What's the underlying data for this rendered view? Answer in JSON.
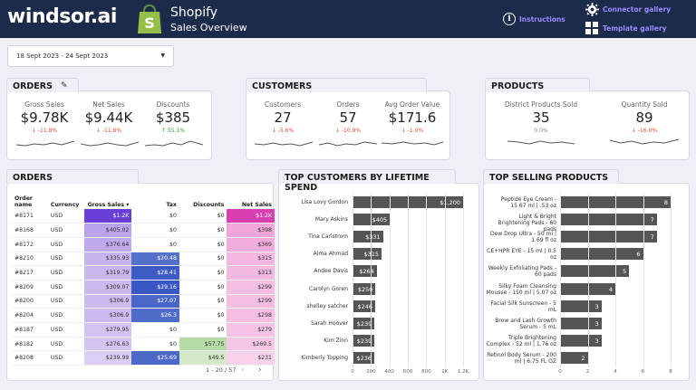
{
  "header": {
    "brand": "windsor.ai",
    "title": "Shopify",
    "subtitle": "Sales Overview",
    "instructions": "Instructions",
    "connector_gallery": "Connector gallery",
    "template_gallery": "Template gallery"
  },
  "date_range": "18 Sept 2023 - 24 Sept 2023",
  "orders_kpi": {
    "title": "ORDERS",
    "items": [
      {
        "label": "Gross Sales",
        "value": "$9.78K",
        "change": "-11.8%",
        "dir": "neg"
      },
      {
        "label": "Net Sales",
        "value": "$9.44K",
        "change": "-11.6%",
        "dir": "neg"
      },
      {
        "label": "Discounts",
        "value": "$385",
        "change": "55.1%",
        "dir": "pos"
      }
    ]
  },
  "customers_kpi": {
    "title": "CUSTOMERS",
    "items": [
      {
        "label": "Customers",
        "value": "27",
        "change": "-5.6%",
        "dir": "neg"
      },
      {
        "label": "Orders",
        "value": "57",
        "change": "-10.9%",
        "dir": "neg"
      },
      {
        "label": "Avg Order Value",
        "value": "$171.6",
        "change": "-1.0%",
        "dir": "neg"
      }
    ]
  },
  "products_kpi": {
    "title": "PRODUCTS",
    "items": [
      {
        "label": "District Products Sold",
        "value": "35",
        "change": "0.0%",
        "dir": "neu"
      },
      {
        "label": "Quantity Sold",
        "value": "89",
        "change": "-16.0%",
        "dir": "neg"
      }
    ]
  },
  "orders_table": {
    "title": "ORDERS",
    "headers": [
      "Order name",
      "Currency",
      "Gross Sales",
      "Tax",
      "Discounts",
      "Net Sales"
    ],
    "sort_indicator": "▾",
    "rows": [
      [
        "#8171",
        "USD",
        "$1.2K",
        "$0",
        "$0",
        "$1.2K"
      ],
      [
        "#8168",
        "USD",
        "$405.02",
        "$0",
        "$0",
        "$398"
      ],
      [
        "#8172",
        "USD",
        "$376.64",
        "$0",
        "$0",
        "$369"
      ],
      [
        "#8210",
        "USD",
        "$335.93",
        "$20.48",
        "$0",
        "$315"
      ],
      [
        "#8217",
        "USD",
        "$319.79",
        "$28.41",
        "$0",
        "$313"
      ],
      [
        "#8209",
        "USD",
        "$309.07",
        "$29.16",
        "$0",
        "$299"
      ],
      [
        "#8200",
        "USD",
        "$306.9",
        "$27.07",
        "$0",
        "$299"
      ],
      [
        "#8204",
        "USD",
        "$306.9",
        "$26.3",
        "$0",
        "$298"
      ],
      [
        "#8187",
        "USD",
        "$279.95",
        "$0",
        "$0",
        "$279"
      ],
      [
        "#8182",
        "USD",
        "$276.63",
        "$0",
        "$57.75",
        "$269.5"
      ],
      [
        "#8208",
        "USD",
        "$239.99",
        "$25.69",
        "$49.5",
        "$231"
      ]
    ],
    "pager_text": "1 - 20 / 57",
    "colors": {
      "gross": [
        "#6a3fd8",
        "#b9a3ea",
        "#bea9ec",
        "#c6b4ee",
        "#c8b6ef",
        "#cab9ef",
        "#cbbaf0",
        "#cbbaf0",
        "#d2c3f2",
        "#d3c4f2",
        "#dbcff5"
      ],
      "tax": [
        "",
        "",
        "",
        "#5470c9",
        "#3d5bc4",
        "#3a58c3",
        "#4a67c7",
        "#4f6bc8",
        "",
        "",
        "#4c68c8"
      ],
      "discounts": [
        "",
        "",
        "",
        "",
        "",
        "",
        "",
        "",
        "",
        "#b7dba7",
        "#d3e9c7"
      ],
      "net": [
        "#d83fb0",
        "#f0a6d9",
        "#f1acdb",
        "#f3b7e0",
        "#f3b8e0",
        "#f4bde2",
        "#f4bde2",
        "#f4bde2",
        "#f5c3e5",
        "#f6c6e6",
        "#f8d2eb"
      ]
    }
  },
  "top_customers": {
    "title": "TOP CUSTOMERS BY LIFETIME SPEND",
    "items": [
      {
        "label": "Lisa Lovy Gordon",
        "value": 1200,
        "display": "$1,200"
      },
      {
        "label": "Mary Askins",
        "value": 405,
        "display": "$405"
      },
      {
        "label": "Tina Carlstrom",
        "value": 331,
        "display": "$331"
      },
      {
        "label": "Alma Ahmad",
        "value": 315,
        "display": "$315"
      },
      {
        "label": "Andee Davis",
        "value": 264,
        "display": "$264"
      },
      {
        "label": "Carolyn Goren",
        "value": 250,
        "display": "$250"
      },
      {
        "label": "shelley satcher",
        "value": 246,
        "display": "$246"
      },
      {
        "label": "Sarah Hoover",
        "value": 239,
        "display": "$239"
      },
      {
        "label": "Kim Zinn",
        "value": 239,
        "display": "$239"
      },
      {
        "label": "Kimberly Topping",
        "value": 236,
        "display": "$236"
      }
    ],
    "ticks": [
      "0",
      "200",
      "400",
      "600",
      "800",
      "1K",
      "1.2K"
    ],
    "max": 1200
  },
  "top_products": {
    "title": "TOP SELLING PRODUCTS",
    "items": [
      {
        "label": "Peptide Eye Cream - 15.67 ml | .53 oz",
        "value": 8
      },
      {
        "label": "Light & Bright Brightening Pads - 60 pads",
        "value": 7
      },
      {
        "label": "Dew Drop Ultra - 50 ml | 1.69 fl oz",
        "value": 7
      },
      {
        "label": "CE+HPR EYE - 15 ml | 0.5 oz",
        "value": 6
      },
      {
        "label": "Weekly Exfoliating Pads - 60 pads",
        "value": 5
      },
      {
        "label": "Silky Foam Cleansing Mousse - 150 ml | 5.07 oz",
        "value": 4
      },
      {
        "label": "Facial Silk Sunscreen - 5 mL",
        "value": 3
      },
      {
        "label": "Brow and Lash Growth Serum - 5 mL",
        "value": 3
      },
      {
        "label": "Triple Brightening Complex - 52 ml | 1.76 oz",
        "value": 3
      },
      {
        "label": "Retinol Body Serum - 200 ml | 6.75 FL OZ",
        "value": 2
      }
    ],
    "ticks": [
      "0",
      "2",
      "4",
      "6",
      "8"
    ],
    "max": 8
  },
  "chart_data": [
    {
      "type": "bar",
      "title": "TOP CUSTOMERS BY LIFETIME SPEND",
      "categories": [
        "Lisa Lovy Gordon",
        "Mary Askins",
        "Tina Carlstrom",
        "Alma Ahmad",
        "Andee Davis",
        "Carolyn Goren",
        "shelley satcher",
        "Sarah Hoover",
        "Kim Zinn",
        "Kimberly Topping"
      ],
      "values": [
        1200,
        405,
        331,
        315,
        264,
        250,
        246,
        239,
        239,
        236
      ],
      "xlim": [
        0,
        1200
      ]
    },
    {
      "type": "bar",
      "title": "TOP SELLING PRODUCTS",
      "categories": [
        "Peptide Eye Cream - 15.67 ml | .53 oz",
        "Light & Bright Brightening Pads - 60 pads",
        "Dew Drop Ultra - 50 ml | 1.69 fl oz",
        "CE+HPR EYE - 15 ml | 0.5 oz",
        "Weekly Exfoliating Pads - 60 pads",
        "Silky Foam Cleansing Mousse - 150 ml | 5.07 oz",
        "Facial Silk Sunscreen - 5 mL",
        "Brow and Lash Growth Serum - 5 mL",
        "Triple Brightening Complex - 52 ml | 1.76 oz",
        "Retinol Body Serum - 200 ml | 6.75 FL OZ"
      ],
      "values": [
        8,
        7,
        7,
        6,
        5,
        4,
        3,
        3,
        3,
        2
      ],
      "xlim": [
        0,
        8
      ]
    }
  ]
}
